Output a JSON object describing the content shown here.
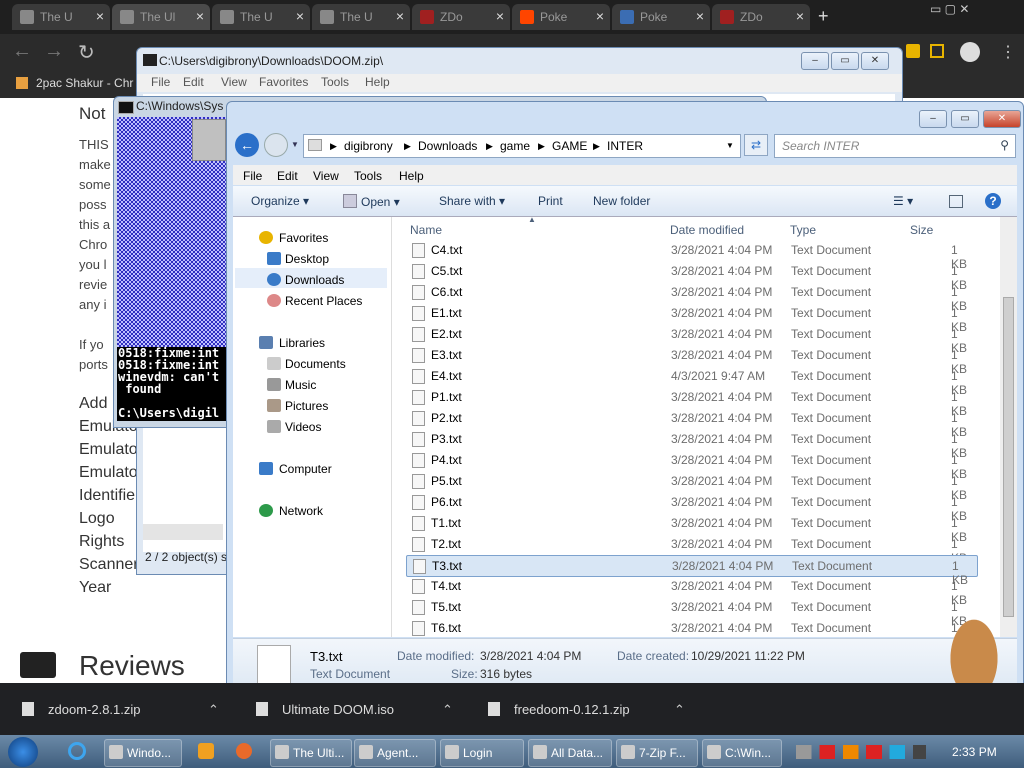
{
  "browser": {
    "tabs": [
      {
        "title": "The U",
        "color": "#888888"
      },
      {
        "title": "The Ul",
        "color": "#888888"
      },
      {
        "title": "The U",
        "color": "#888888"
      },
      {
        "title": "The U",
        "color": "#888888"
      },
      {
        "title": "ZDo",
        "color": "#a02020"
      },
      {
        "title": "Poke",
        "color": "#ff4500"
      },
      {
        "title": "Poke",
        "color": "#3b6db3"
      },
      {
        "title": "ZDo",
        "color": "#a02020"
      }
    ],
    "bookmark": "2pac Shakur - Chr"
  },
  "webpage": {
    "heading": "Not",
    "paragraph_lines": [
      "THIS",
      "make",
      "some",
      "poss",
      "this a",
      "Chro",
      "you l",
      "revie",
      "any i"
    ],
    "paragraph2_lines": [
      "If yo",
      "ports"
    ],
    "meta_labels": [
      "Add",
      "Emulato",
      "Emulato",
      "Emulato",
      "Identifie",
      "Logo",
      "Rights",
      "Scanner",
      "Year"
    ],
    "reviews": "Reviews"
  },
  "zip_window": {
    "title": "C:\\Users\\digibrony\\Downloads\\DOOM.zip\\",
    "menu": [
      "File",
      "Edit",
      "View",
      "Favorites",
      "Tools",
      "Help"
    ],
    "status": "2 / 2 object(s) s"
  },
  "cmd_window": {
    "title": "C:\\Windows\\Sys",
    "lines": [
      "0518:fixme:int",
      "0518:fixme:int",
      "winevdm: can't",
      " found",
      "",
      "C:\\Users\\digil"
    ]
  },
  "explorer": {
    "breadcrumbs": [
      "digibrony",
      "Downloads",
      "game",
      "GAME",
      "INTER"
    ],
    "search_placeholder": "Search INTER",
    "menu": [
      "File",
      "Edit",
      "View",
      "Tools",
      "Help"
    ],
    "commands": [
      "Organize",
      "Open",
      "Share with",
      "Print",
      "New folder"
    ],
    "nav": {
      "favorites": "Favorites",
      "desktop": "Desktop",
      "downloads": "Downloads",
      "recent": "Recent Places",
      "libraries": "Libraries",
      "documents": "Documents",
      "music": "Music",
      "pictures": "Pictures",
      "videos": "Videos",
      "computer": "Computer",
      "network": "Network"
    },
    "columns": [
      "Name",
      "Date modified",
      "Type",
      "Size"
    ],
    "files": [
      {
        "name": "C4.txt",
        "date": "3/28/2021 4:04 PM",
        "type": "Text Document",
        "size": "1 KB"
      },
      {
        "name": "C5.txt",
        "date": "3/28/2021 4:04 PM",
        "type": "Text Document",
        "size": "1 KB"
      },
      {
        "name": "C6.txt",
        "date": "3/28/2021 4:04 PM",
        "type": "Text Document",
        "size": "1 KB"
      },
      {
        "name": "E1.txt",
        "date": "3/28/2021 4:04 PM",
        "type": "Text Document",
        "size": "1 KB"
      },
      {
        "name": "E2.txt",
        "date": "3/28/2021 4:04 PM",
        "type": "Text Document",
        "size": "1 KB"
      },
      {
        "name": "E3.txt",
        "date": "3/28/2021 4:04 PM",
        "type": "Text Document",
        "size": "1 KB"
      },
      {
        "name": "E4.txt",
        "date": "4/3/2021 9:47 AM",
        "type": "Text Document",
        "size": "1 KB"
      },
      {
        "name": "P1.txt",
        "date": "3/28/2021 4:04 PM",
        "type": "Text Document",
        "size": "1 KB"
      },
      {
        "name": "P2.txt",
        "date": "3/28/2021 4:04 PM",
        "type": "Text Document",
        "size": "1 KB"
      },
      {
        "name": "P3.txt",
        "date": "3/28/2021 4:04 PM",
        "type": "Text Document",
        "size": "1 KB"
      },
      {
        "name": "P4.txt",
        "date": "3/28/2021 4:04 PM",
        "type": "Text Document",
        "size": "1 KB"
      },
      {
        "name": "P5.txt",
        "date": "3/28/2021 4:04 PM",
        "type": "Text Document",
        "size": "1 KB"
      },
      {
        "name": "P6.txt",
        "date": "3/28/2021 4:04 PM",
        "type": "Text Document",
        "size": "1 KB"
      },
      {
        "name": "T1.txt",
        "date": "3/28/2021 4:04 PM",
        "type": "Text Document",
        "size": "1 KB"
      },
      {
        "name": "T2.txt",
        "date": "3/28/2021 4:04 PM",
        "type": "Text Document",
        "size": "1 KB"
      },
      {
        "name": "T3.txt",
        "date": "3/28/2021 4:04 PM",
        "type": "Text Document",
        "size": "1 KB",
        "selected": true
      },
      {
        "name": "T4.txt",
        "date": "3/28/2021 4:04 PM",
        "type": "Text Document",
        "size": "1 KB"
      },
      {
        "name": "T5.txt",
        "date": "3/28/2021 4:04 PM",
        "type": "Text Document",
        "size": "1 KB"
      },
      {
        "name": "T6.txt",
        "date": "3/28/2021 4:04 PM",
        "type": "Text Document",
        "size": "1 KB"
      }
    ],
    "details": {
      "name": "T3.txt",
      "type": "Text Document",
      "modified_label": "Date modified:",
      "modified": "3/28/2021 4:04 PM",
      "created_label": "Date created:",
      "created": "10/29/2021 11:22 PM",
      "size_label": "Size:",
      "size": "316 bytes"
    }
  },
  "downloads": [
    "zdoom-2.8.1.zip",
    "Ultimate DOOM.iso",
    "freedoom-0.12.1.zip"
  ],
  "taskbar": {
    "buttons": [
      "Windo...",
      "The Ulti...",
      "Agent...",
      "Login",
      "All Data...",
      "7-Zip F...",
      "C:\\Win..."
    ],
    "clock": "2:33 PM"
  }
}
